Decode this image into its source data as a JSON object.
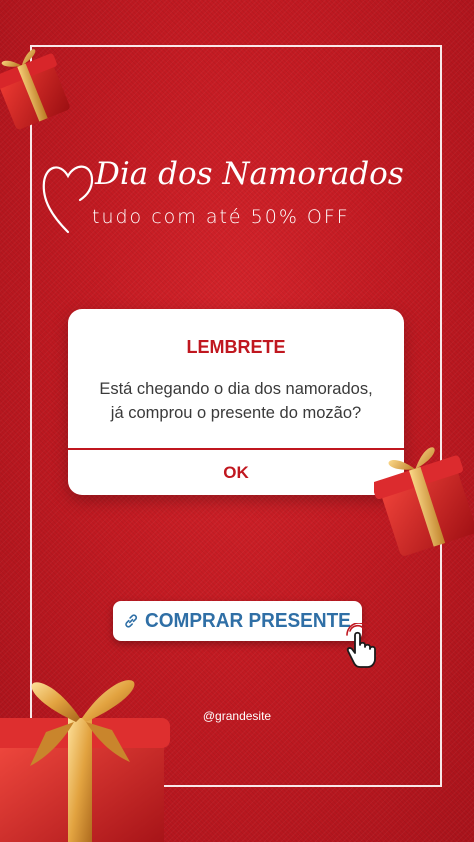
{
  "header": {
    "title": "Dia dos Namorados",
    "subtitle": "tudo com até 50% OFF"
  },
  "dialog": {
    "title": "LEMBRETE",
    "message_line1": "Está chegando o dia dos namorados,",
    "message_line2": "já comprou o presente do mozão?",
    "ok_label": "OK"
  },
  "cta": {
    "label": "COMPRAR PRESENTE"
  },
  "footer": {
    "handle": "@grandesite"
  },
  "icons": [
    "heart-outline-icon",
    "link-icon",
    "pointing-hand-icon",
    "gift-box-icon"
  ],
  "colors": {
    "background": "#c21a22",
    "accent": "#c0171f",
    "cta_text": "#2f6fa6",
    "gold": "#e9b04a"
  }
}
